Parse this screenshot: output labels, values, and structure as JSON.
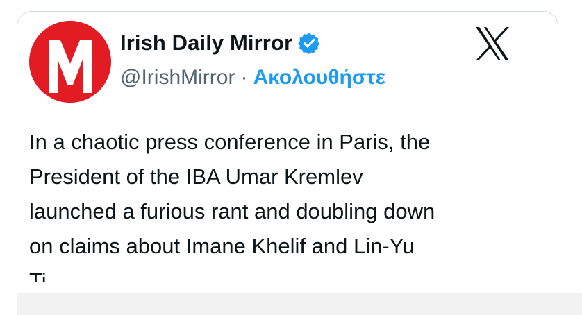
{
  "tweet": {
    "account_name": "Irish Daily Mirror",
    "handle": "@IrishMirror",
    "separator": "·",
    "follow_label": "Ακολουθήστε",
    "avatar_letter": "M",
    "text_lines": [
      "In a chaotic press conference in Paris, the",
      "President of the IBA Umar Kremlev",
      "launched a furious rant and doubling down",
      "on claims about Imane Khelif and Lin-Yu",
      "Ti..."
    ]
  },
  "icons": {
    "verified": "verified-badge-icon",
    "platform": "x-logo-icon",
    "avatar": "mirror-logo-icon"
  },
  "colors": {
    "brand_red": "#e31b23",
    "verified_blue": "#1d9bf0",
    "follow_blue": "#1d9bf0",
    "text": "#0f1419",
    "muted": "#536471",
    "border": "#cfd9de"
  }
}
